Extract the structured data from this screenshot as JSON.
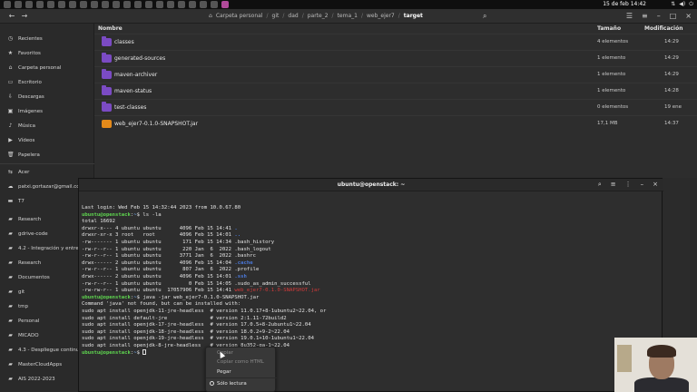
{
  "topbar": {
    "clock": "15 de feb 14:42",
    "tray_icons": [
      "network-icon",
      "speaker-icon",
      "power-icon"
    ]
  },
  "header": {
    "back_icon": "arrow-left-icon",
    "forward_icon": "arrow-right-icon",
    "breadcrumbs": [
      "Carpeta personal",
      "git",
      "dad",
      "parte_2",
      "tema_1",
      "web_ejer7",
      "target"
    ],
    "search_icon": "search-icon"
  },
  "sidebar": {
    "items": [
      {
        "label": "Recientes",
        "icon": "clock-icon"
      },
      {
        "label": "Favoritos",
        "icon": "star-icon"
      },
      {
        "label": "Carpeta personal",
        "icon": "home-icon"
      },
      {
        "label": "Escritorio",
        "icon": "desktop-icon"
      },
      {
        "label": "Descargas",
        "icon": "download-icon"
      },
      {
        "label": "Imágenes",
        "icon": "image-icon"
      },
      {
        "label": "Música",
        "icon": "music-icon"
      },
      {
        "label": "Vídeos",
        "icon": "video-icon"
      },
      {
        "label": "Papelera",
        "icon": "trash-icon"
      },
      {
        "label": "Acer",
        "icon": "network-drive-icon"
      },
      {
        "label": "patxi.gortazar@gmail.com",
        "icon": "cloud-icon"
      },
      {
        "label": "T7",
        "icon": "drive-icon"
      },
      {
        "label": "Research",
        "icon": "folder-icon"
      },
      {
        "label": "gdrive-code",
        "icon": "folder-icon"
      },
      {
        "label": "4.2 - Integración y entreg...",
        "icon": "folder-icon"
      },
      {
        "label": "Research",
        "icon": "folder-icon"
      },
      {
        "label": "Documentos",
        "icon": "folder-icon"
      },
      {
        "label": "git",
        "icon": "folder-icon"
      },
      {
        "label": "tmp",
        "icon": "folder-icon"
      },
      {
        "label": "Personal",
        "icon": "folder-icon"
      },
      {
        "label": "MICADO",
        "icon": "folder-icon"
      },
      {
        "label": "4.3 - Despliegue continuo",
        "icon": "folder-icon"
      },
      {
        "label": "MasterCloudApps",
        "icon": "folder-icon"
      },
      {
        "label": "AIS 2022-2023",
        "icon": "folder-icon"
      }
    ]
  },
  "files": {
    "columns": {
      "name": "Nombre",
      "size": "Tamaño",
      "modified": "Modificación"
    },
    "rows": [
      {
        "name": "classes",
        "size": "4 elementos",
        "modified": "14:29",
        "type": "folder"
      },
      {
        "name": "generated-sources",
        "size": "1 elemento",
        "modified": "14:29",
        "type": "folder"
      },
      {
        "name": "maven-archiver",
        "size": "1 elemento",
        "modified": "14:29",
        "type": "folder"
      },
      {
        "name": "maven-status",
        "size": "1 elemento",
        "modified": "14:28",
        "type": "folder"
      },
      {
        "name": "test-classes",
        "size": "0 elementos",
        "modified": "19 ene",
        "type": "folder"
      },
      {
        "name": "web_ejer7-0.1.0-SNAPSHOT.jar",
        "size": "17,1 MB",
        "modified": "14:37",
        "type": "jar"
      }
    ]
  },
  "terminal": {
    "title": "ubuntu@openstack: ~",
    "lines": [
      [
        {
          "t": "Last login: Wed Feb 15 14:32:44 2023 from 10.0.67.80"
        }
      ],
      [
        {
          "t": "ubuntu@openstack",
          "c": "prompt"
        },
        {
          "t": ":"
        },
        {
          "t": "~",
          "c": "path"
        },
        {
          "t": "$ ls -la"
        }
      ],
      [
        {
          "t": "total 16692"
        }
      ],
      [
        {
          "t": "drwxr-x--- 4 ubuntu ubuntu      4096 Feb 15 14:41 "
        },
        {
          "t": ".",
          "c": "bl"
        }
      ],
      [
        {
          "t": "drwxr-xr-x 3 root   root        4096 Feb 15 14:01 "
        },
        {
          "t": "..",
          "c": "bl"
        }
      ],
      [
        {
          "t": "-rw------- 1 ubuntu ubuntu       171 Feb 15 14:34 .bash_history"
        }
      ],
      [
        {
          "t": "-rw-r--r-- 1 ubuntu ubuntu       220 Jan  6  2022 .bash_logout"
        }
      ],
      [
        {
          "t": "-rw-r--r-- 1 ubuntu ubuntu      3771 Jan  6  2022 .bashrc"
        }
      ],
      [
        {
          "t": "drwx------ 2 ubuntu ubuntu      4096 Feb 15 14:04 "
        },
        {
          "t": ".cache",
          "c": "bl"
        }
      ],
      [
        {
          "t": "-rw-r--r-- 1 ubuntu ubuntu       807 Jan  6  2022 .profile"
        }
      ],
      [
        {
          "t": "drwx------ 2 ubuntu ubuntu      4096 Feb 15 14:01 "
        },
        {
          "t": ".ssh",
          "c": "bl"
        }
      ],
      [
        {
          "t": "-rw-r--r-- 1 ubuntu ubuntu         0 Feb 15 14:05 .sudo_as_admin_successful"
        }
      ],
      [
        {
          "t": "-rw-rw-r-- 1 ubuntu ubuntu  17057906 Feb 15 14:41 "
        },
        {
          "t": "web_ejer7-0.1.0-SNAPSHOT.jar",
          "c": "rd"
        }
      ],
      [
        {
          "t": "ubuntu@openstack",
          "c": "prompt"
        },
        {
          "t": ":"
        },
        {
          "t": "~",
          "c": "path"
        },
        {
          "t": "$ java -jar web_ejer7-0.1.0-SNAPSHOT.jar"
        }
      ],
      [
        {
          "t": "Command 'java' not found, but can be installed with:"
        }
      ],
      [
        {
          "t": "sudo apt install openjdk-11-jre-headless  # version 11.0.17+8-1ubuntu2~22.04, or"
        }
      ],
      [
        {
          "t": "sudo apt install default-jre              # version 2:1.11-72build2"
        }
      ],
      [
        {
          "t": "sudo apt install openjdk-17-jre-headless  # version 17.0.5+8-2ubuntu1~22.04"
        }
      ],
      [
        {
          "t": "sudo apt install openjdk-18-jre-headless  # version 18.0.2+9-2~22.04"
        }
      ],
      [
        {
          "t": "sudo apt install openjdk-19-jre-headless  # version 19.0.1+10-1ubuntu1~22.04"
        }
      ],
      [
        {
          "t": "sudo apt install openjdk-8-jre-headless   # version 8u352-ga-1~22.04"
        }
      ],
      [
        {
          "t": "ubuntu@openstack",
          "c": "prompt"
        },
        {
          "t": ":"
        },
        {
          "t": "~",
          "c": "path"
        },
        {
          "t": "$ "
        },
        {
          "t": "",
          "c": "cursor"
        }
      ]
    ]
  },
  "context_menu": {
    "items": [
      "Copiar",
      "Copiar como HTML",
      "Pegar",
      "Sólo lectura"
    ]
  }
}
